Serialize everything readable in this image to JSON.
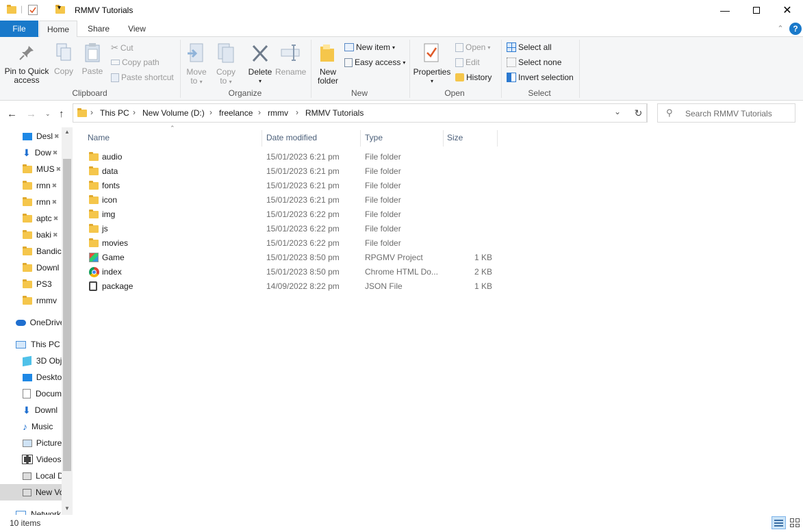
{
  "window": {
    "title": "RMMV Tutorials"
  },
  "tabs": [
    "File",
    "Home",
    "Share",
    "View"
  ],
  "ribbon": {
    "clipboard": {
      "pin": "Pin to Quick access",
      "pin_l1": "Pin to Quick",
      "pin_l2": "access",
      "copy": "Copy",
      "paste": "Paste",
      "cut": "Cut",
      "copy_path": "Copy path",
      "paste_shortcut": "Paste shortcut",
      "label": "Clipboard"
    },
    "organize": {
      "move_l1": "Move",
      "move_l2": "to",
      "copy_l1": "Copy",
      "copy_l2": "to",
      "delete": "Delete",
      "rename": "Rename",
      "label": "Organize"
    },
    "new": {
      "folder_l1": "New",
      "folder_l2": "folder",
      "new_item": "New item",
      "easy_access": "Easy access",
      "label": "New"
    },
    "open": {
      "properties": "Properties",
      "open": "Open",
      "edit": "Edit",
      "history": "History",
      "label": "Open"
    },
    "select": {
      "select_all": "Select all",
      "select_none": "Select none",
      "invert": "Invert selection",
      "label": "Select"
    }
  },
  "address": {
    "crumbs": [
      "This PC",
      "New Volume (D:)",
      "freelance",
      "rmmv",
      "RMMV Tutorials"
    ],
    "search_placeholder": "Search RMMV Tutorials"
  },
  "nav_pane": {
    "quick_access": [
      "Desl",
      "Dow",
      "MUS",
      "rmn",
      "rmn",
      "aptc",
      "baki",
      "Bandic",
      "Downl",
      "PS3",
      "rmmv"
    ],
    "onedrive": "OneDrive",
    "this_pc": "This PC",
    "pc_items": [
      "3D Obj",
      "Deskto",
      "Docum",
      "Downl",
      "Music",
      "Picture",
      "Videos",
      "Local D",
      "New Vo"
    ],
    "network": "Network"
  },
  "columns": {
    "name": "Name",
    "date": "Date modified",
    "type": "Type",
    "size": "Size"
  },
  "files": [
    {
      "name": "audio",
      "date": "15/01/2023 6:21 pm",
      "type": "File folder",
      "size": "",
      "icon": "folder-icon"
    },
    {
      "name": "data",
      "date": "15/01/2023 6:21 pm",
      "type": "File folder",
      "size": "",
      "icon": "folder-icon"
    },
    {
      "name": "fonts",
      "date": "15/01/2023 6:21 pm",
      "type": "File folder",
      "size": "",
      "icon": "folder-icon"
    },
    {
      "name": "icon",
      "date": "15/01/2023 6:21 pm",
      "type": "File folder",
      "size": "",
      "icon": "folder-icon"
    },
    {
      "name": "img",
      "date": "15/01/2023 6:22 pm",
      "type": "File folder",
      "size": "",
      "icon": "folder-icon"
    },
    {
      "name": "js",
      "date": "15/01/2023 6:22 pm",
      "type": "File folder",
      "size": "",
      "icon": "folder-icon"
    },
    {
      "name": "movies",
      "date": "15/01/2023 6:22 pm",
      "type": "File folder",
      "size": "",
      "icon": "folder-icon"
    },
    {
      "name": "Game",
      "date": "15/01/2023 8:50 pm",
      "type": "RPGMV Project",
      "size": "1 KB",
      "icon": "rpgmv-project-icon"
    },
    {
      "name": "index",
      "date": "15/01/2023 8:50 pm",
      "type": "Chrome HTML Do...",
      "size": "2 KB",
      "icon": "chrome-icon"
    },
    {
      "name": "package",
      "date": "14/09/2022 8:22 pm",
      "type": "JSON File",
      "size": "1 KB",
      "icon": "json-file-icon"
    }
  ],
  "status": {
    "items": "10 items"
  },
  "colors": {
    "accent": "#1979ca",
    "folder": "#f5c64b"
  }
}
